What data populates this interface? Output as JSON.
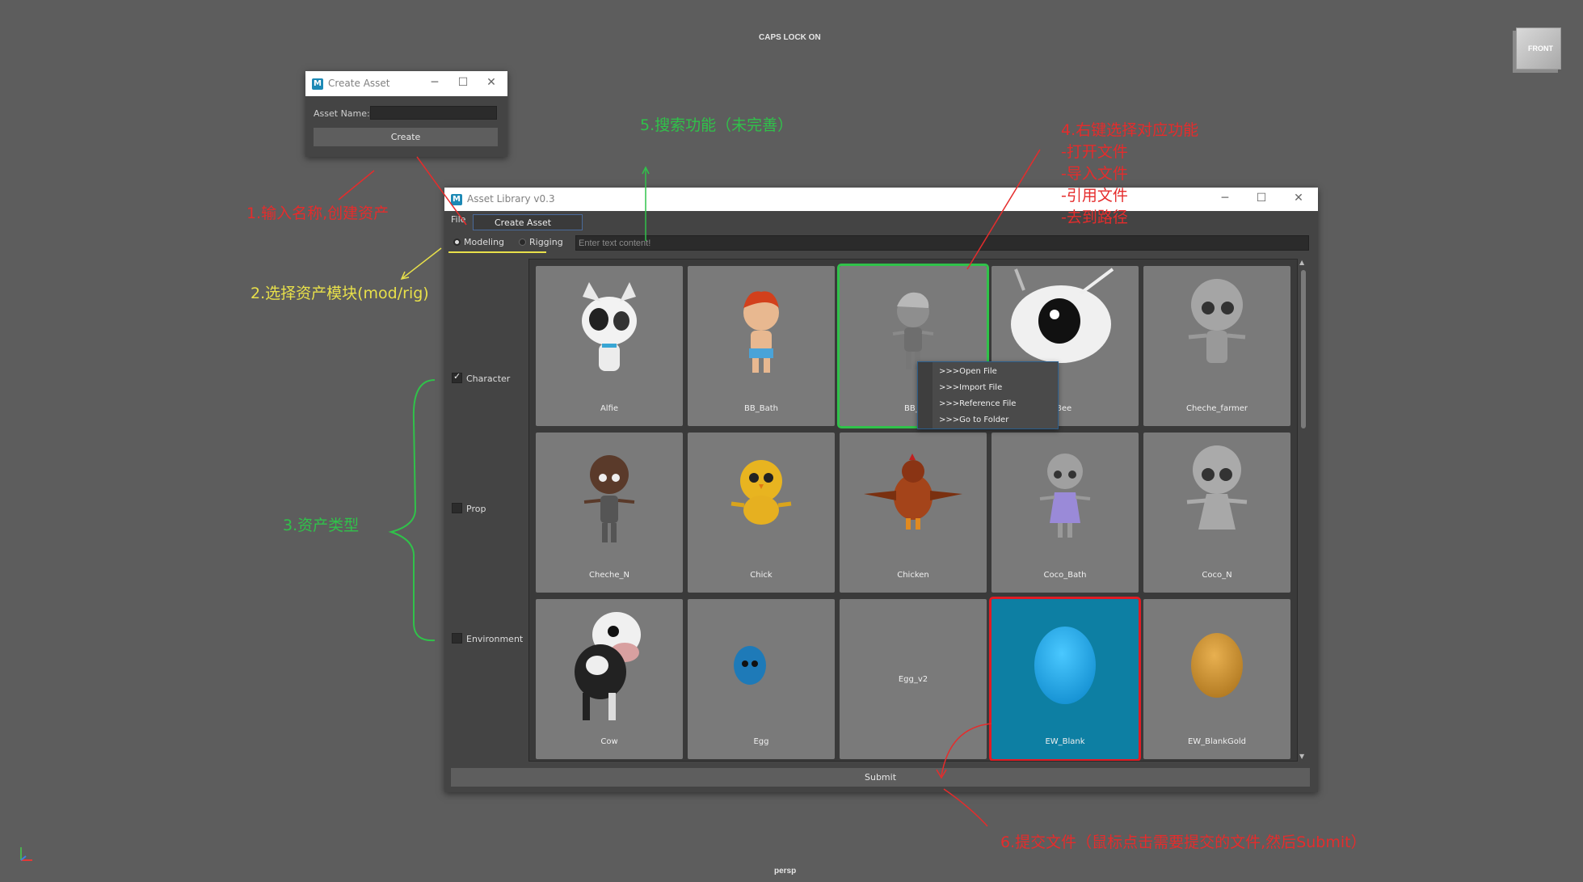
{
  "viewport": {
    "caps_lock": "CAPS LOCK ON",
    "camera": "persp",
    "view_cube_label": "FRONT"
  },
  "create_window": {
    "title": "Create Asset",
    "asset_name_label": "Asset Name:",
    "asset_name_value": "",
    "create_button": "Create"
  },
  "library_window": {
    "title": "Asset Library v0.3",
    "menu_file": "File",
    "menu_create_asset": "Create Asset",
    "modes": [
      {
        "label": "Modeling",
        "selected": true
      },
      {
        "label": "Rigging",
        "selected": false
      }
    ],
    "search_placeholder": "Enter text content!",
    "categories": [
      {
        "label": "Character",
        "checked": true
      },
      {
        "label": "Prop",
        "checked": false
      },
      {
        "label": "Environment",
        "checked": false
      }
    ],
    "assets": [
      {
        "name": "Alfie"
      },
      {
        "name": "BB_Bath"
      },
      {
        "name": "BB_"
      },
      {
        "name": "Bee"
      },
      {
        "name": "Cheche_farmer"
      },
      {
        "name": "Cheche_N"
      },
      {
        "name": "Chick"
      },
      {
        "name": "Chicken"
      },
      {
        "name": "Coco_Bath"
      },
      {
        "name": "Coco_N"
      },
      {
        "name": "Cow"
      },
      {
        "name": "Egg"
      },
      {
        "name": "Egg_v2"
      },
      {
        "name": "EW_Blank",
        "selected": true
      },
      {
        "name": "EW_BlankGold"
      }
    ],
    "context_menu": [
      ">>>Open File",
      ">>>Import File",
      ">>>Reference File",
      ">>>Go to Folder"
    ],
    "submit_button": "Submit"
  },
  "annotations": {
    "a1": "1.输入名称,创建资产",
    "a2": "2.选择资产模块(mod/rig)",
    "a3": "3.资产类型",
    "a4": [
      "4.右键选择对应功能",
      "-打开文件",
      "-导入文件",
      "-引用文件",
      "-去到路径"
    ],
    "a5": "5.搜索功能（未完善）",
    "a6": "6.提交文件（鼠标点击需要提交的文件,然后Submit）"
  },
  "colors": {
    "annotation_red": "#e52c2c",
    "annotation_yellow": "#e8e04a",
    "annotation_green": "#30c24a",
    "selection_blue": "#0d7fa3"
  }
}
